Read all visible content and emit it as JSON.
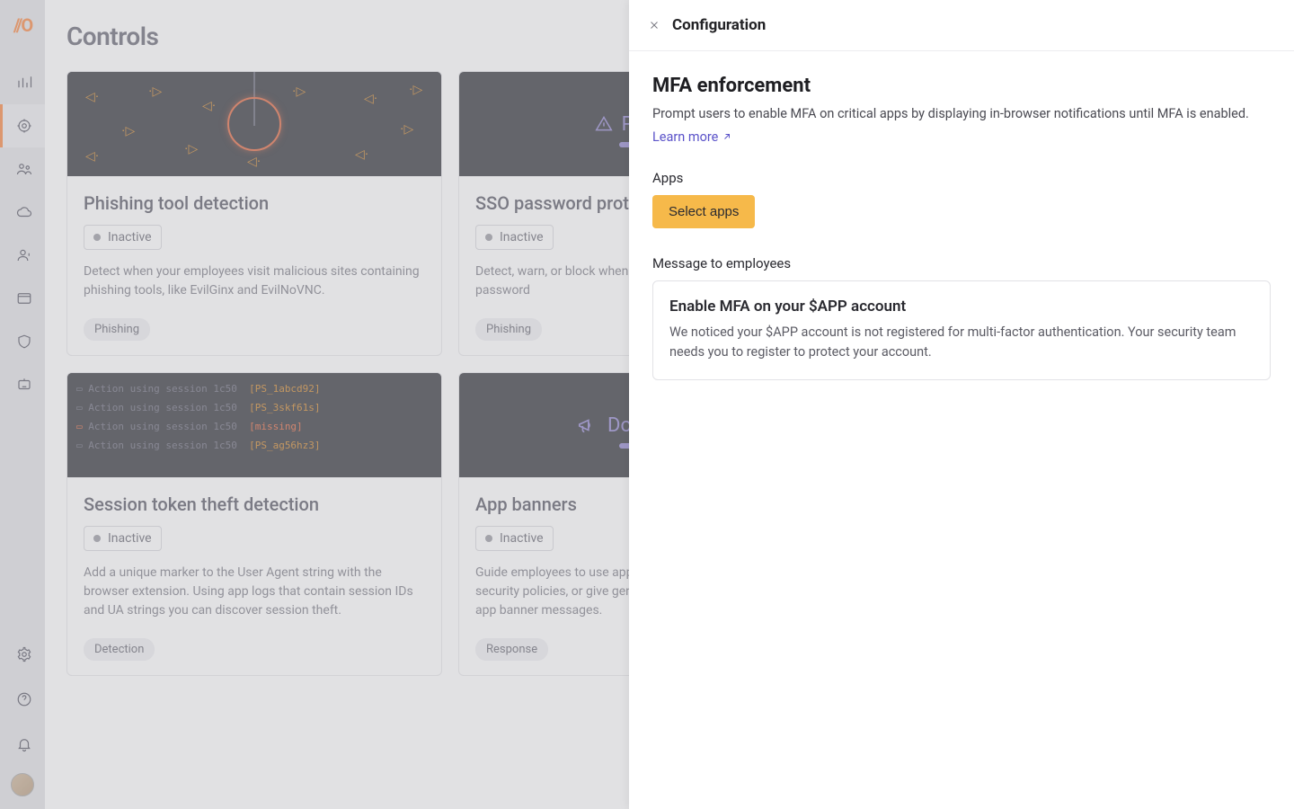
{
  "page": {
    "title": "Controls"
  },
  "nav": {
    "items": [
      {
        "name": "analytics-icon"
      },
      {
        "name": "target-icon"
      },
      {
        "name": "people-icon"
      },
      {
        "name": "cloud-icon"
      },
      {
        "name": "user-warn-icon"
      },
      {
        "name": "window-icon"
      },
      {
        "name": "shield-icon"
      },
      {
        "name": "chat-bot-icon"
      }
    ],
    "bottom": [
      {
        "name": "gear-icon"
      },
      {
        "name": "help-icon"
      },
      {
        "name": "bell-icon"
      }
    ]
  },
  "cards": [
    {
      "title": "Phishing tool detection",
      "status": "Inactive",
      "desc": "Detect when your employees visit malicious sites containing phishing tools, like EvilGinx and EvilNoVNC.",
      "tags": [
        "Phishing"
      ],
      "illus": "phish"
    },
    {
      "title": "SSO password protection",
      "status": "Inactive",
      "desc": "Detect, warn, or block when employees enter their SSO password",
      "tags": [
        "Phishing"
      ],
      "illus": "sso",
      "illus_label": "Phishing"
    },
    {
      "title": "",
      "status": "",
      "desc": "",
      "tags": [],
      "illus": "hidden"
    },
    {
      "title": "Session token theft detection",
      "status": "Inactive",
      "desc": "Add a unique marker to the User Agent string with the browser extension. Using app logs that contain session IDs and UA strings you can discover session theft.",
      "tags": [
        "Detection"
      ],
      "illus": "code"
    },
    {
      "title": "App banners",
      "status": "Inactive",
      "desc": "Guide employees to use approved apps, remind them of security policies, or give general guidance with in-browser app banner messages.",
      "tags": [
        "Response"
      ],
      "illus": "banner",
      "illus_label": "Do not enter"
    }
  ],
  "code_lines": [
    {
      "prefix": "Action using session 1c50",
      "suffix": "[PS_1abcd92]"
    },
    {
      "prefix": "Action using session 1c50",
      "suffix": "[PS_3skf61s]"
    },
    {
      "prefix": "Action using session 1c50",
      "suffix": "[missing]",
      "miss": true
    },
    {
      "prefix": "Action using session 1c50",
      "suffix": "[PS_ag56hz3]"
    }
  ],
  "drawer": {
    "header": "Configuration",
    "title": "MFA enforcement",
    "desc": "Prompt users to enable MFA on critical apps by displaying in-browser notifications until MFA is enabled.",
    "learn_more": "Learn more",
    "apps_label": "Apps",
    "select_apps_btn": "Select apps",
    "message_label": "Message to employees",
    "msg_title": "Enable MFA on your $APP account",
    "msg_body": "We noticed your $APP account is not registered for multi-factor authentication. Your security team needs you to register to protect your account."
  }
}
